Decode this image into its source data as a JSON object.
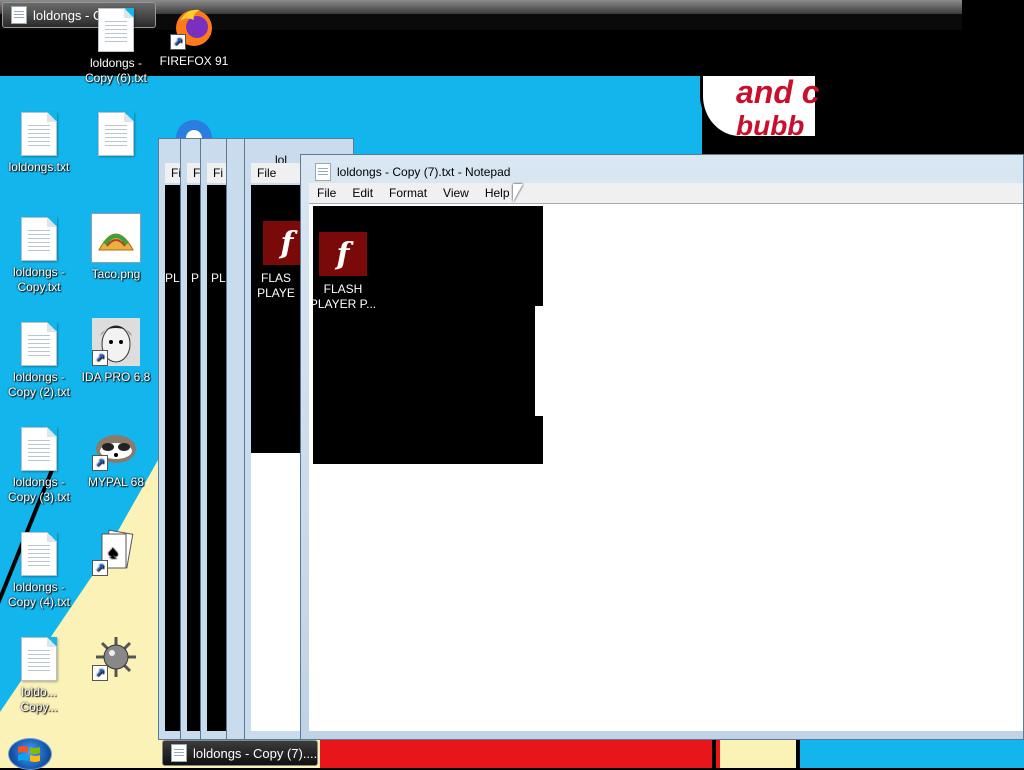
{
  "top_taskbar": {
    "label": "loldongs - Co..."
  },
  "desktop_icons": [
    {
      "label": "loldongs - Copy (6).txt"
    },
    {
      "label": "FIREFOX 91"
    },
    {
      "label": "loldongs.txt"
    },
    {
      "label": "loldongs - Copy.txt"
    },
    {
      "label": "Taco.png"
    },
    {
      "label": "loldongs - Copy (2).txt"
    },
    {
      "label": "IDA PRO 6.8"
    },
    {
      "label": "loldongs - Copy (3).txt"
    },
    {
      "label": "MYPAL 68"
    },
    {
      "label": "loldongs - Copy (4).txt"
    },
    {
      "label": "loldo... Copy..."
    }
  ],
  "wallpaper_text": {
    "line1": "and c",
    "line2": "bubb"
  },
  "stacked_windows": [
    {
      "menu": "Fi",
      "icon_label": "PL"
    },
    {
      "menu": "Fi",
      "icon_label": "PL"
    },
    {
      "menu": "Fi",
      "icon_label": "PL"
    },
    {
      "menu": "File",
      "icon_label": "FLAS PLAYE"
    }
  ],
  "stacked_title_fragment": "lol",
  "notepad": {
    "title": "loldongs - Copy (7).txt - Notepad",
    "menu": [
      "File",
      "Edit",
      "Format",
      "View",
      "Help"
    ],
    "content_icon": {
      "label": "FLASH PLAYER P..."
    }
  },
  "taskbar": {
    "active_window": "loldongs - Copy (7)...."
  }
}
